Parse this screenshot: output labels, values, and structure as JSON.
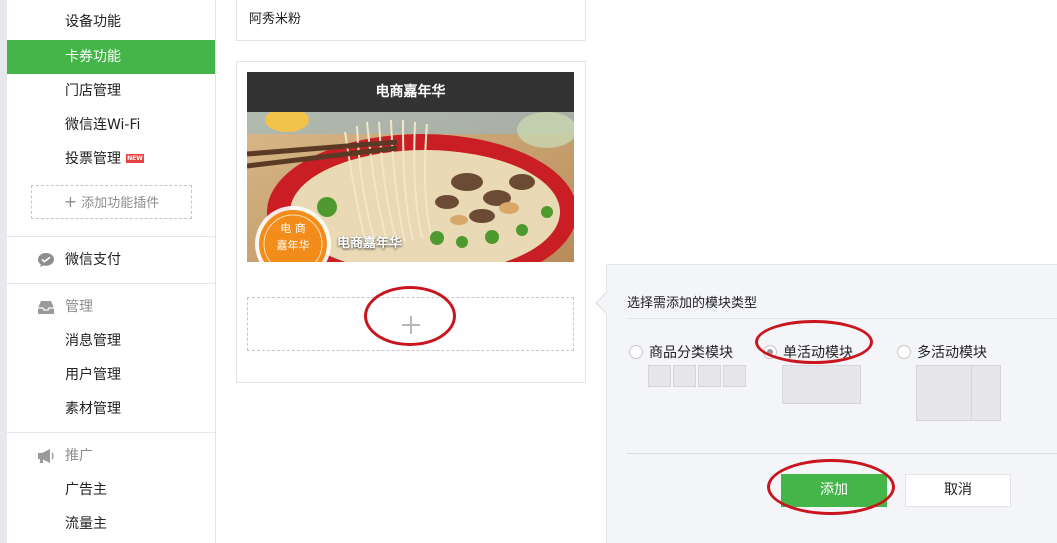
{
  "sidebar": {
    "items": [
      {
        "label": "设备功能"
      },
      {
        "label": "卡券功能"
      },
      {
        "label": "门店管理"
      },
      {
        "label": "微信连Wi-Fi"
      },
      {
        "label": "投票管理"
      }
    ],
    "new_badge": "NEW",
    "add_plugin_label": "添加功能插件",
    "pay_label": "微信支付",
    "manage_label": "管理",
    "manage_items": [
      {
        "label": "消息管理"
      },
      {
        "label": "用户管理"
      },
      {
        "label": "素材管理"
      }
    ],
    "promote_label": "推广",
    "promote_items": [
      {
        "label": "广告主"
      },
      {
        "label": "流量主"
      }
    ],
    "active_color": "#44b549"
  },
  "main": {
    "store_name": "阿秀米粉",
    "banner_title": "电商嘉年华",
    "banner_caption": "电商嘉年华",
    "badge_top": "电 商",
    "badge_bottom": "嘉年华"
  },
  "popover": {
    "title": "选择需添加的模块类型",
    "options": [
      {
        "label": "商品分类模块",
        "checked": false
      },
      {
        "label": "单活动模块",
        "checked": true
      },
      {
        "label": "多活动模块",
        "checked": false
      }
    ],
    "add_label": "添加",
    "cancel_label": "取消"
  },
  "colors": {
    "green": "#44b549",
    "annotation_red": "#c9151e"
  }
}
